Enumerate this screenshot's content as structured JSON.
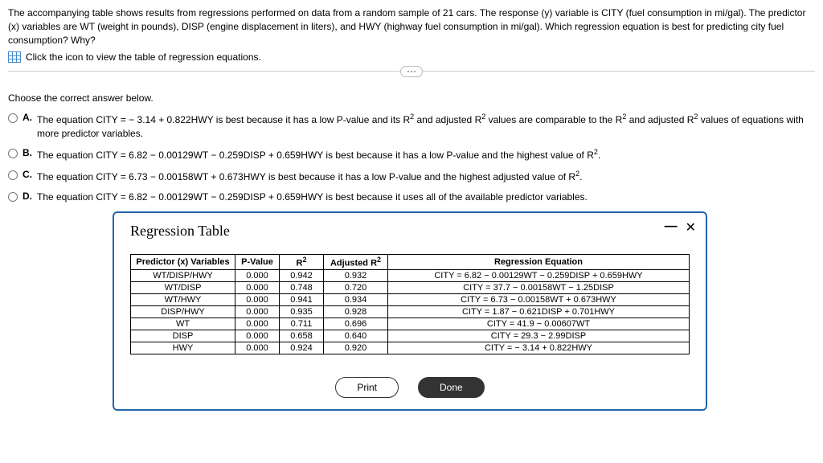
{
  "intro": "The accompanying table shows results from regressions performed on data from a random sample of 21 cars. The response (y) variable is CITY (fuel consumption in mi/gal). The predictor (x) variables are WT (weight in pounds), DISP (engine displacement in liters), and HWY (highway fuel consumption in mi/gal). Which regression equation is best for predicting city fuel consumption? Why?",
  "table_link_label": "Click the icon to view the table of regression equations.",
  "prompt": "Choose the correct answer below.",
  "options": {
    "a": {
      "letter": "A."
    },
    "b": {
      "letter": "B."
    },
    "c": {
      "letter": "C."
    },
    "d": {
      "letter": "D."
    }
  },
  "modal": {
    "title": "Regression Table",
    "headers": {
      "predictor": "Predictor (x) Variables",
      "pvalue": "P-Value",
      "equation": "Regression Equation"
    },
    "rows": [
      {
        "pred": "WT/DISP/HWY",
        "p": "0.000",
        "r2": "0.942",
        "ar2": "0.932",
        "eq": "CITY = 6.82 − 0.00129WT − 0.259DISP + 0.659HWY"
      },
      {
        "pred": "WT/DISP",
        "p": "0.000",
        "r2": "0.748",
        "ar2": "0.720",
        "eq": "CITY = 37.7 − 0.00158WT − 1.25DISP"
      },
      {
        "pred": "WT/HWY",
        "p": "0.000",
        "r2": "0.941",
        "ar2": "0.934",
        "eq": "CITY = 6.73 − 0.00158WT + 0.673HWY"
      },
      {
        "pred": "DISP/HWY",
        "p": "0.000",
        "r2": "0.935",
        "ar2": "0.928",
        "eq": "CITY = 1.87 − 0.621DISP + 0.701HWY"
      },
      {
        "pred": "WT",
        "p": "0.000",
        "r2": "0.711",
        "ar2": "0.696",
        "eq": "CITY = 41.9 − 0.00607WT"
      },
      {
        "pred": "DISP",
        "p": "0.000",
        "r2": "0.658",
        "ar2": "0.640",
        "eq": "CITY = 29.3 − 2.99DISP"
      },
      {
        "pred": "HWY",
        "p": "0.000",
        "r2": "0.924",
        "ar2": "0.920",
        "eq": "CITY = − 3.14 + 0.822HWY"
      }
    ],
    "buttons": {
      "print": "Print",
      "done": "Done"
    }
  }
}
